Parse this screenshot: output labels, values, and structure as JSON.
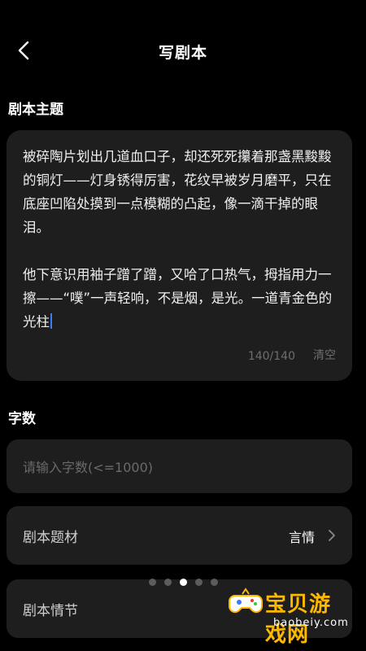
{
  "header": {
    "title": "写剧本"
  },
  "topic": {
    "label": "剧本主题",
    "text": "被碎陶片划出几道血口子，却还死死攥着那盏黑黢黢的铜灯——灯身锈得厉害，花纹早被岁月磨平，只在底座凹陷处摸到一点模糊的凸起，像一滴干掉的眼泪。\n\n他下意识用袖子蹭了蹭，又哈了口热气，拇指用力一擦——“噗”一声轻响，不是烟，是光。一道青金色的光柱",
    "counter": "140/140",
    "clear_label": "清空"
  },
  "word_count": {
    "label": "字数",
    "placeholder": "请输入字数(<=1000)",
    "value": ""
  },
  "rows": [
    {
      "label": "剧本题材",
      "value": "言情"
    },
    {
      "label": "剧本情节",
      "value": ""
    }
  ],
  "pager": {
    "count": 5,
    "active_index": 2
  },
  "watermark": {
    "text": "宝贝游戏网",
    "url": "baobeiy.com"
  },
  "colors": {
    "background": "#000000",
    "card": "#1e1e1e",
    "caret": "#3a7bff",
    "watermark_accent": "#ffb800"
  }
}
